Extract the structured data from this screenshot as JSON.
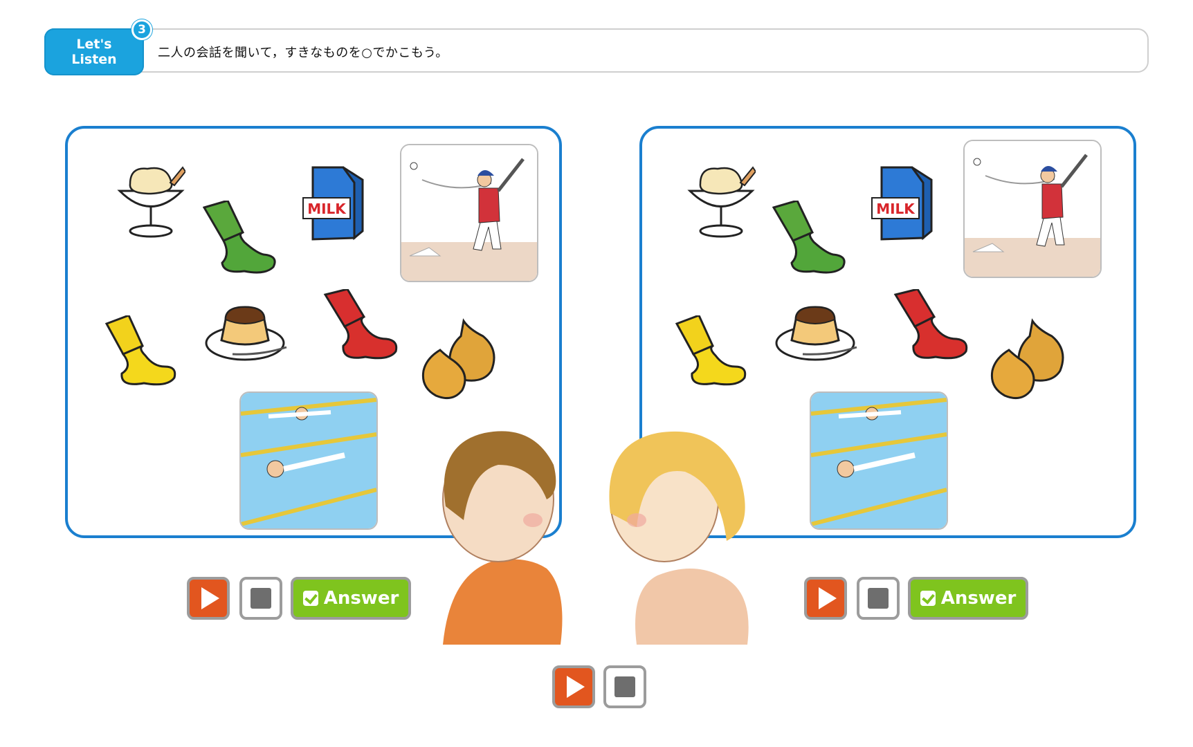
{
  "header": {
    "badge_line1": "Let's",
    "badge_line2": "Listen",
    "number": "3",
    "instruction": "二人の会話を聞いて，すきなものを○でかこもう。"
  },
  "panels": [
    {
      "name": "left",
      "items": [
        "ice-cream",
        "green-paint",
        "milk",
        "baseball",
        "yellow-paint",
        "pudding",
        "red-paint",
        "onions",
        "swimming"
      ],
      "milk_label": "MILK"
    },
    {
      "name": "right",
      "items": [
        "ice-cream",
        "green-paint",
        "milk",
        "baseball",
        "yellow-paint",
        "pudding",
        "red-paint",
        "onions",
        "swimming"
      ],
      "milk_label": "MILK"
    }
  ],
  "controls": {
    "answer_label": "Answer"
  },
  "colors": {
    "accent_blue": "#1ba3de",
    "panel_border": "#1a7fcf",
    "play_orange": "#e2561f",
    "answer_green": "#7fc41e"
  }
}
